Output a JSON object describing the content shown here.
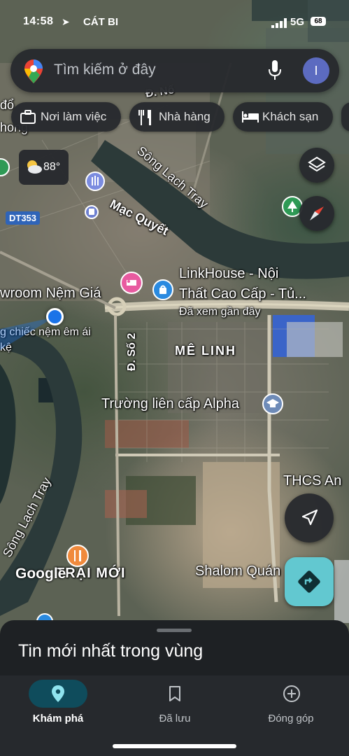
{
  "status_bar": {
    "time": "14:58",
    "carrier": "CÁT BI",
    "network": "5G",
    "battery": "68"
  },
  "search": {
    "placeholder": "Tìm kiếm ở đây",
    "avatar_letter": "I",
    "icons": [
      "maps-pin-logo",
      "mic-icon"
    ]
  },
  "chips": [
    {
      "label": "Nơi làm việc",
      "icon": "briefcase-icon"
    },
    {
      "label": "Nhà hàng",
      "icon": "restaurant-icon"
    },
    {
      "label": "Khách sạn",
      "icon": "hotel-icon"
    }
  ],
  "weather": {
    "temp": "88°",
    "icon": "partly-cloudy-icon"
  },
  "map_labels": {
    "river_top": "Sông Lạch Tray",
    "river_left": "Sông Lạch Tray",
    "street_mac_quyet": "Mạc Quyết",
    "road_badge": "DT353",
    "showroom": "wroom Nệm Giá",
    "showroom_sub": "g chiếc nệm êm ái",
    "showroom_sub2": "kệ",
    "linkhouse_line1": "LinkHouse - Nội",
    "linkhouse_line2": "Thất Cao Cấp - Tủ...",
    "linkhouse_sub": "Đã xem gần đây",
    "district": "MÊ LINH",
    "street_so2": "Đ. Số 2",
    "school": "Trường liên cấp Alpha",
    "thcs": "THCS An",
    "shalom": "Shalom Quán",
    "trai_moi": "TRẠI MỚI",
    "top_frag_1": "Đ. Nổ",
    "top_frag_2": "đổ",
    "top_frag_3": "hong",
    "google": "Google"
  },
  "bottom_sheet": {
    "title": "Tin mới nhất trong vùng"
  },
  "nav": [
    {
      "label": "Khám phá",
      "icon": "location-pin-icon",
      "active": true
    },
    {
      "label": "Đã lưu",
      "icon": "bookmark-icon",
      "active": false
    },
    {
      "label": "Đóng góp",
      "icon": "add-circle-icon",
      "active": false
    }
  ],
  "colors": {
    "accent": "#62c8d0",
    "user_dot": "#1a73e8",
    "nav_active_pill": "#0f4c5c",
    "panel": "#282a2e"
  }
}
